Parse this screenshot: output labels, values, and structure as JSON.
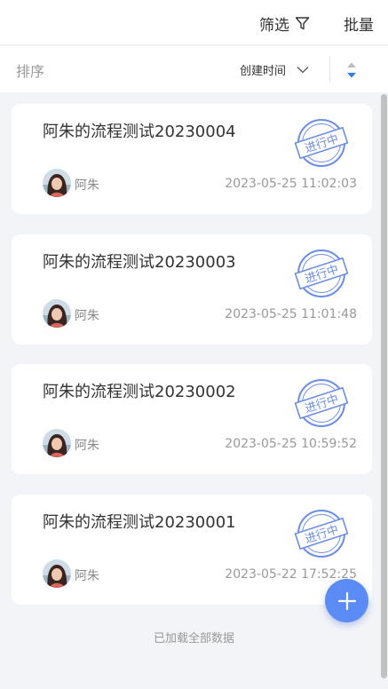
{
  "header": {
    "filter_label": "筛选",
    "batch_label": "批量"
  },
  "sort": {
    "label": "排序",
    "field": "创建时间"
  },
  "stamp_text": "进行中",
  "records": [
    {
      "title": "阿朱的流程测试20230004",
      "author": "阿朱",
      "time": "2023-05-25 11:02:03",
      "status": "进行中"
    },
    {
      "title": "阿朱的流程测试20230003",
      "author": "阿朱",
      "time": "2023-05-25 11:01:48",
      "status": "进行中"
    },
    {
      "title": "阿朱的流程测试20230002",
      "author": "阿朱",
      "time": "2023-05-25 10:59:52",
      "status": "进行中"
    },
    {
      "title": "阿朱的流程测试20230001",
      "author": "阿朱",
      "time": "2023-05-22 17:52:25",
      "status": "进行中"
    }
  ],
  "footer": {
    "loaded_all": "已加载全部数据"
  },
  "colors": {
    "accent": "#5b8cf5",
    "stamp": "#6a8ee8",
    "sort_active": "#2f7de1"
  },
  "icons": {
    "filter": "funnel-icon",
    "sort_field": "chevron-down-icon",
    "sort_order": "sort-order-icon",
    "add": "plus-icon"
  }
}
